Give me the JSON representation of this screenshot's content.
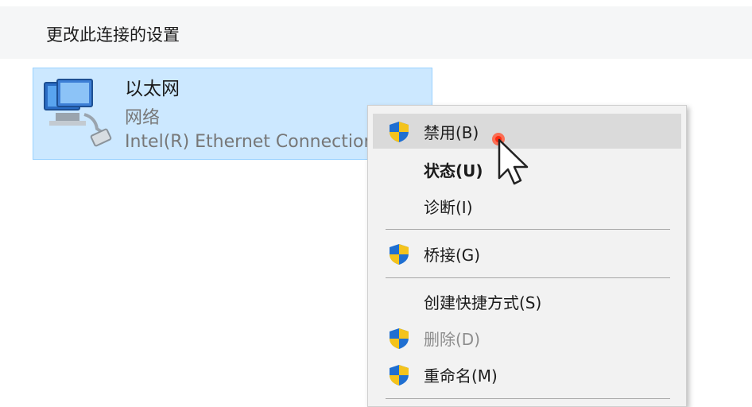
{
  "toolbar": {
    "change_settings": "更改此连接的设置"
  },
  "connection": {
    "name": "以太网",
    "type": "网络",
    "adapter": "Intel(R) Ethernet Connection"
  },
  "menu": {
    "disable": "禁用(B)",
    "status": "状态(U)",
    "diagnose": "诊断(I)",
    "bridge": "桥接(G)",
    "create_shortcut": "创建快捷方式(S)",
    "delete": "删除(D)",
    "rename": "重命名(M)"
  },
  "colors": {
    "selection_bg": "#cce8ff",
    "selection_border": "#99d1ff",
    "menu_bg": "#f2f2f2",
    "menu_hover": "#dadada",
    "shield_blue": "#1f6fd1",
    "shield_yellow": "#f4c31c"
  }
}
